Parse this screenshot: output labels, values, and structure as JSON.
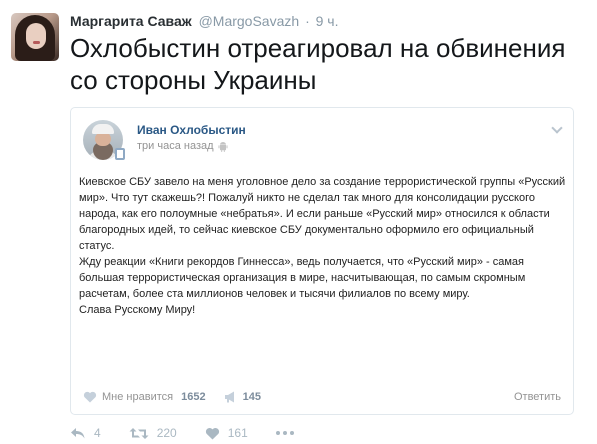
{
  "tweet": {
    "author_name": "Маргарита Саваж",
    "handle": "@MargoSavazh",
    "separator": "·",
    "time": "9 ч.",
    "text": "Охлобыстин отреагировал на обвинения со стороны Украины",
    "actions": {
      "reply_count": "4",
      "retweet_count": "220",
      "like_count": "161"
    }
  },
  "card": {
    "author": "Иван Охлобыстин",
    "posted": "три часа назад",
    "paragraphs": [
      "Киевское СБУ завело на меня уголовное дело за создание террористической группы «Русский мир». Что тут скажешь?! Пожалуй никто не сделал так много для консолидации русского народа, как его полоумные «небратья». И если раньше «Русский мир» относился к области благородных идей, то сейчас киевское СБУ документально оформило его официальный статус.",
      "Жду реакции «Книги рекордов Гиннесса», ведь получается, что «Русский мир» - самая большая террористическая организация в мире, насчитывающая, по самым скромным расчетам, более ста миллионов человек и тысячи филиалов по всему миру.",
      "Слава Русскому Миру!"
    ],
    "footer": {
      "like_label": "Мне нравится",
      "like_count": "1652",
      "share_count": "145",
      "reply_label": "Ответить"
    }
  },
  "icons": {
    "reply": "reply-icon",
    "retweet": "retweet-icon",
    "like": "heart-icon",
    "more": "more-icon",
    "vk_like": "heart-icon",
    "vk_share": "megaphone-icon",
    "android": "android-icon",
    "mobile": "mobile-icon",
    "dropdown": "chevron-down-icon"
  },
  "colors": {
    "vk_link": "#2a5885",
    "twitter_grey": "#8899a6",
    "action_grey": "#aab8c2"
  }
}
